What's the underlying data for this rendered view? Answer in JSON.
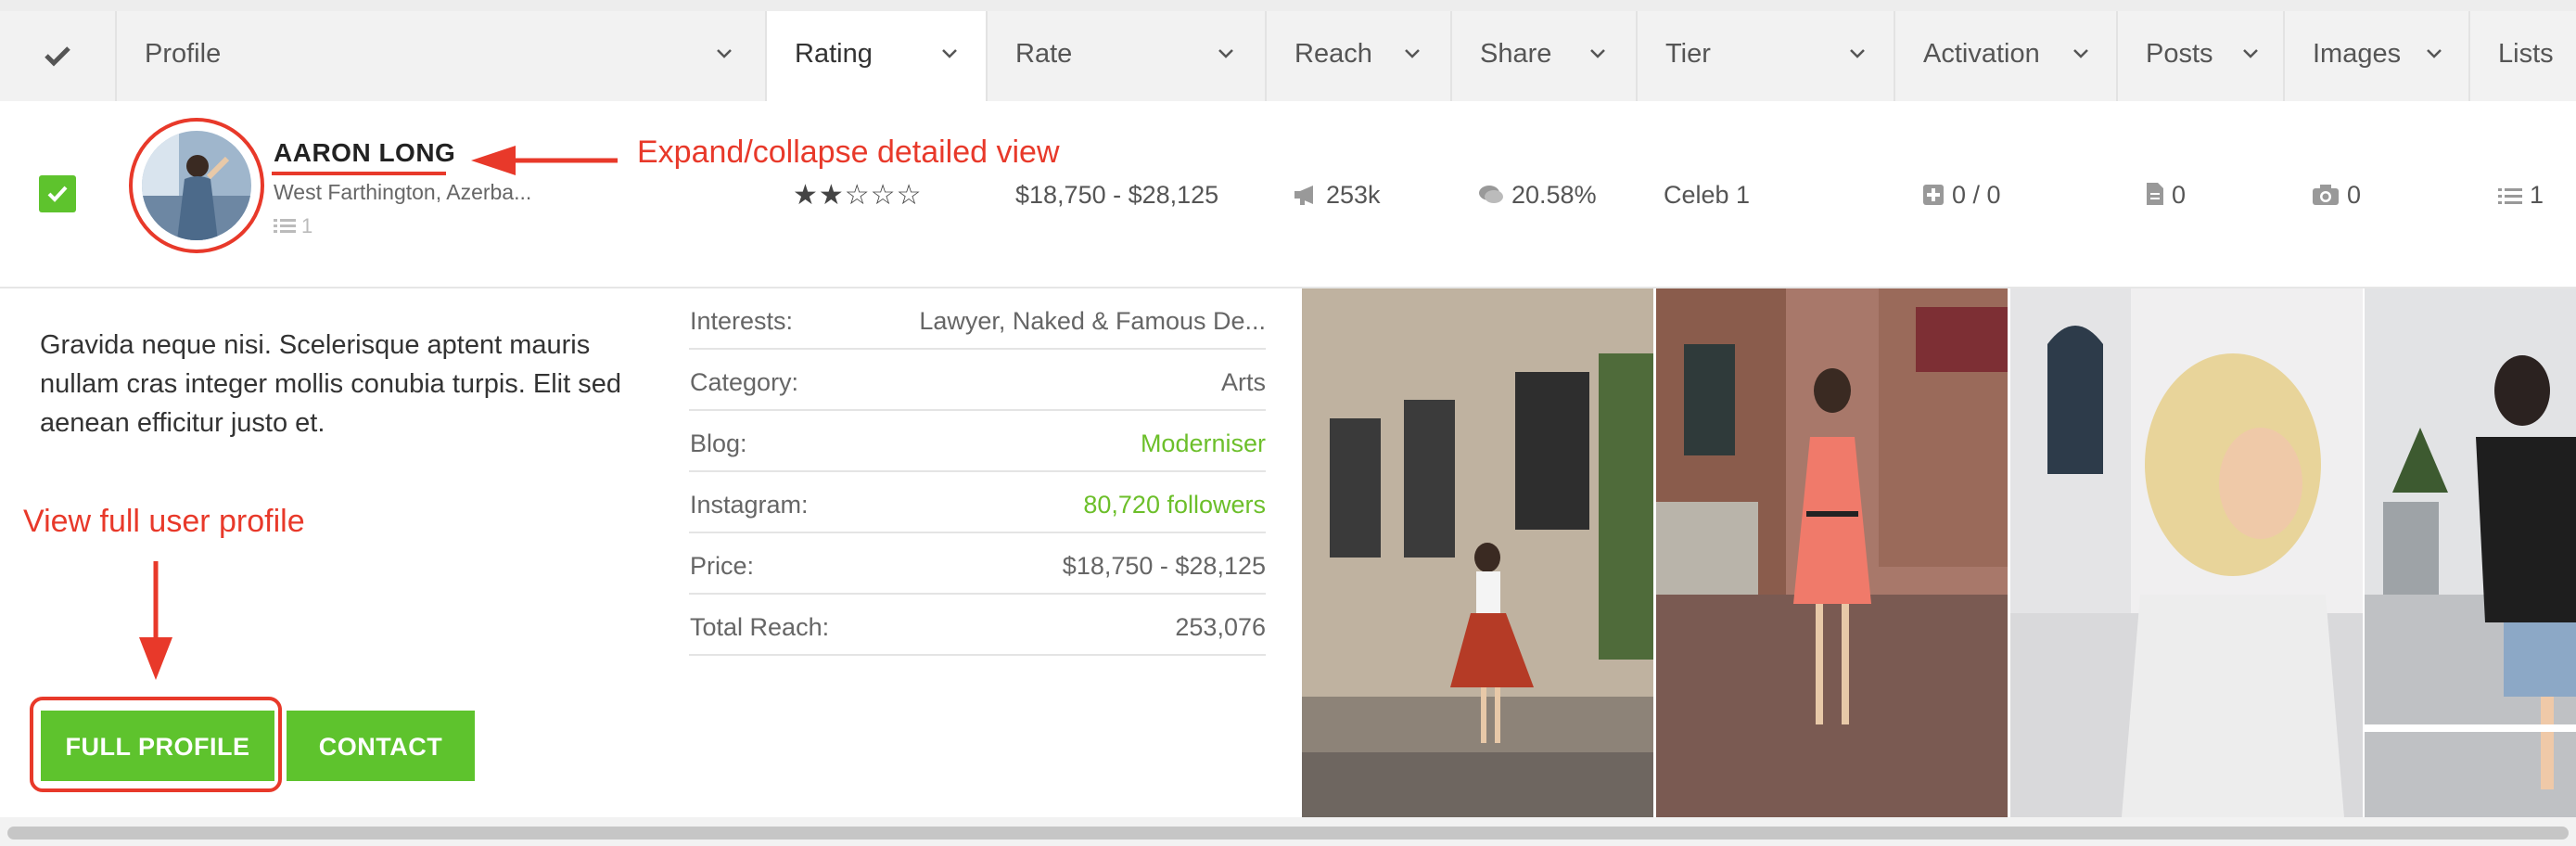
{
  "header": {
    "columns": [
      {
        "label": "Profile"
      },
      {
        "label": "Rating"
      },
      {
        "label": "Rate"
      },
      {
        "label": "Reach"
      },
      {
        "label": "Share"
      },
      {
        "label": "Tier"
      },
      {
        "label": "Activation"
      },
      {
        "label": "Posts"
      },
      {
        "label": "Images"
      },
      {
        "label": "Lists"
      }
    ],
    "active_column": "Rating"
  },
  "row": {
    "selected": true,
    "name": "AARON LONG",
    "location": "West Farthington, Azerba...",
    "list_count": "1",
    "rating": {
      "value": 2,
      "max": 5,
      "display": "★★☆☆☆"
    },
    "rate": "$18,750 - $28,125",
    "reach": "253k",
    "share": "20.58%",
    "tier": "Celeb 1",
    "activation": "0 / 0",
    "posts": "0",
    "images": "0",
    "lists": "1"
  },
  "detail": {
    "description": "Gravida neque nisi. Scelerisque aptent mauris nullam cras integer mollis conubia turpis. Elit sed aenean efficitur justo et.",
    "info": [
      {
        "key": "Interests:",
        "value": "Lawyer, Naked & Famous De...",
        "color": "#666666"
      },
      {
        "key": "Category:",
        "value": "Arts",
        "color": "#666666"
      },
      {
        "key": "Blog:",
        "value": "Moderniser",
        "color": "#6cbf2a"
      },
      {
        "key": "Instagram:",
        "value": "80,720 followers",
        "color": "#6cbf2a"
      },
      {
        "key": "Price:",
        "value": "$18,750 - $28,125",
        "color": "#666666"
      },
      {
        "key": "Total Reach:",
        "value": "253,076",
        "color": "#666666"
      }
    ],
    "buttons": {
      "full_profile": "FULL PROFILE",
      "contact": "CONTACT"
    }
  },
  "annotations": {
    "expand": "Expand/collapse detailed view",
    "full_profile": "View full user profile"
  },
  "colors": {
    "accent": "#5ec32d",
    "annotation": "#e8392a",
    "link": "#6cbf2a"
  }
}
